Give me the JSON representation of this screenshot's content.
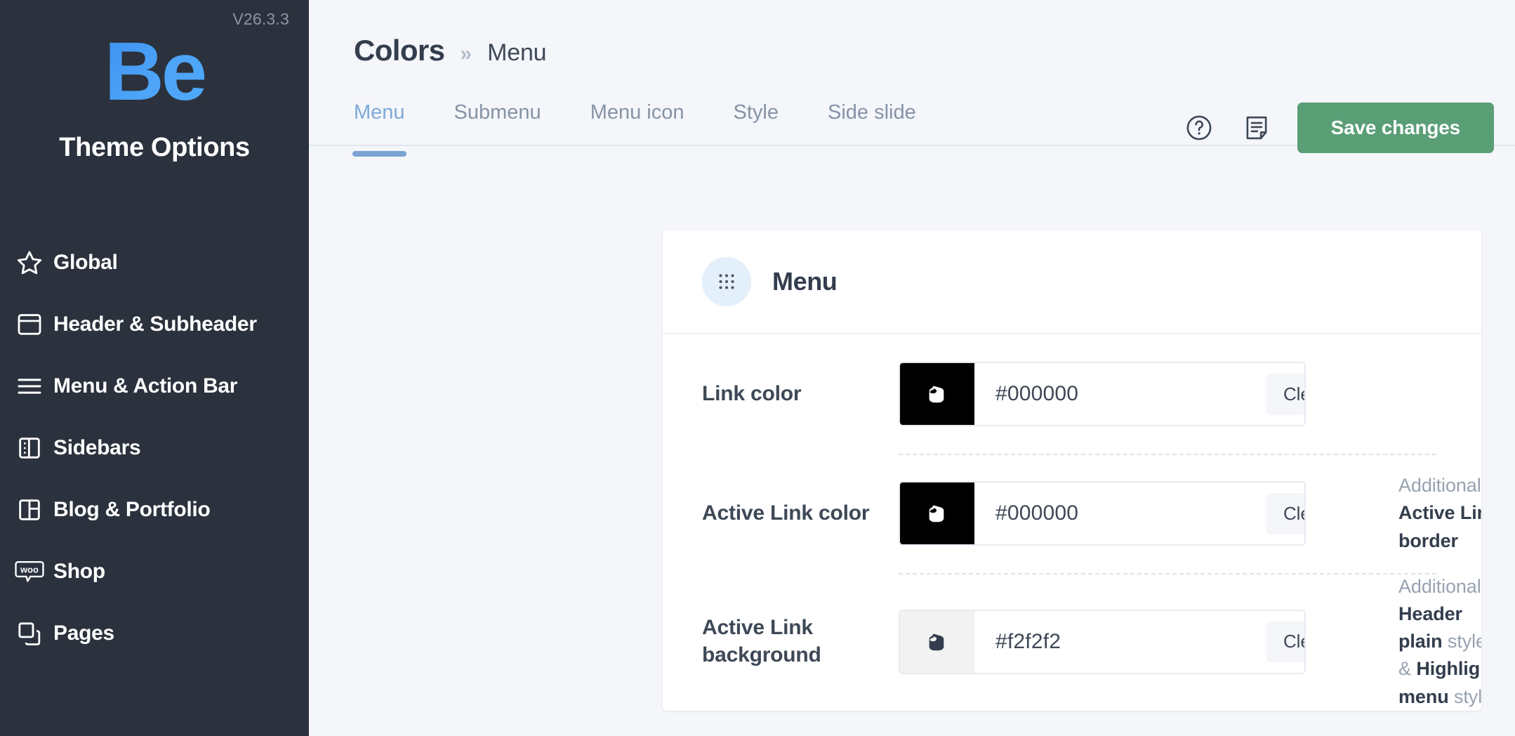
{
  "sidebar": {
    "version": "V26.3.3",
    "logo_text": "Be",
    "title": "Theme Options",
    "items": [
      {
        "label": "Global",
        "icon": "star-icon"
      },
      {
        "label": "Header & Subheader",
        "icon": "header-layout-icon"
      },
      {
        "label": "Menu & Action Bar",
        "icon": "hamburger-icon"
      },
      {
        "label": "Sidebars",
        "icon": "sidebar-layout-icon"
      },
      {
        "label": "Blog & Portfolio",
        "icon": "grid-layout-icon"
      },
      {
        "label": "Shop",
        "icon": "woocommerce-icon"
      },
      {
        "label": "Pages",
        "icon": "copy-pages-icon"
      }
    ]
  },
  "header": {
    "breadcrumb_root": "Colors",
    "breadcrumb_separator": "»",
    "breadcrumb_leaf": "Menu",
    "tabs": [
      {
        "label": "Menu",
        "active": true
      },
      {
        "label": "Submenu",
        "active": false
      },
      {
        "label": "Menu icon",
        "active": false
      },
      {
        "label": "Style",
        "active": false
      },
      {
        "label": "Side slide",
        "active": false
      }
    ],
    "help_icon": "question-circle-icon",
    "notes_icon": "notes-document-icon",
    "save_label": "Save changes",
    "save_color": "#5a9e76",
    "active_tab_color": "#7fa8d8"
  },
  "card": {
    "icon": "dots-grid-icon",
    "title": "Menu",
    "rows": [
      {
        "label": "Link color",
        "value": "#000000",
        "swatch_color": "#000000",
        "swatch_icon": "paint-bucket-icon",
        "clear_label": "Clear",
        "extra_prefix": "",
        "extra_html": ""
      },
      {
        "label": "Active Link color",
        "value": "#000000",
        "swatch_color": "#000000",
        "swatch_icon": "paint-bucket-icon",
        "clear_label": "Clear",
        "extra_prefix": "Additionally: ",
        "extra_html": "Additionally: <b>Active Link border</b>"
      },
      {
        "label": "Active Link background",
        "value": "#f2f2f2",
        "swatch_color": "#f2f2f2",
        "swatch_icon": "paint-bucket-icon",
        "clear_label": "Clear",
        "extra_prefix": "Additionally: ",
        "extra_html": "Additionally: <b>Header plain</b> style &amp; <b>Highlight menu</b> style"
      }
    ]
  }
}
